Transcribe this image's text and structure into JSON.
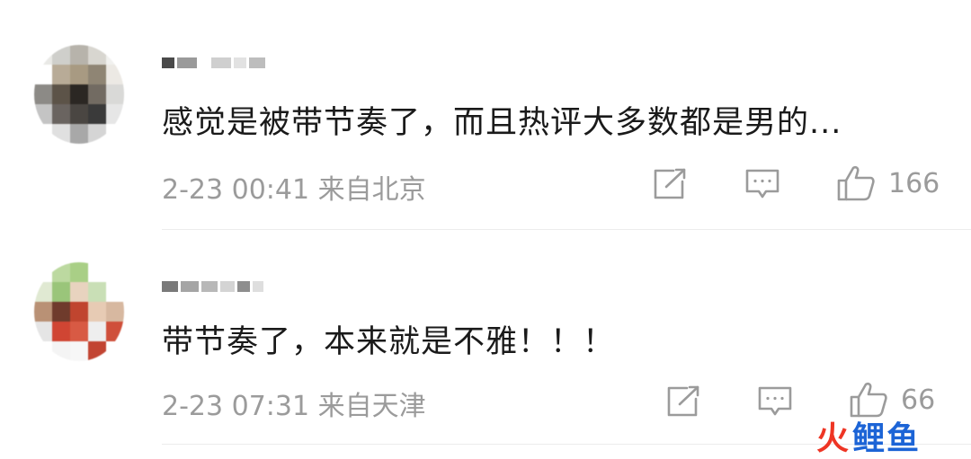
{
  "comments": [
    {
      "text": "感觉是被带节奏了，而且热评大多数都是男的...",
      "time": "2-23 00:41",
      "location": "来自北京",
      "likes": "166",
      "username_blurred": true,
      "avatar_colors": [
        "#e9e9e6",
        "#cfcfcb",
        "#b7b3ab",
        "#d8d6d0",
        "#f1f1ef",
        "#ffffff",
        "#b8ab97",
        "#a89a82",
        "#8f8574",
        "#ece9e4",
        "#8c8a86",
        "#5c5348",
        "#2b2723",
        "#726b62",
        "#d9d9d7",
        "#c4c4c4",
        "#6a6460",
        "#4a4642",
        "#3a3a3a",
        "#e6e6e6",
        "#ffffff",
        "#e0e0e0",
        "#a8a8a8",
        "#d5d5d5",
        "#ffffff"
      ]
    },
    {
      "text": "带节奏了，本来就是不雅！！！",
      "time": "2-23 07:31",
      "location": "来自天津",
      "likes": "66",
      "username_blurred": true,
      "avatar_colors": [
        "#ffffff",
        "#bcd9a0",
        "#a9cf86",
        "#ffffff",
        "#ffffff",
        "#e0e9d2",
        "#9ac57a",
        "#e8d3bf",
        "#c9dfb6",
        "#ffffff",
        "#b99175",
        "#6f3b2c",
        "#c0452f",
        "#e7cbb4",
        "#d7b8a0",
        "#e5e5e5",
        "#d04533",
        "#d85a44",
        "#eeeeee",
        "#cf4f3a",
        "#ffffff",
        "#f4f4f4",
        "#f7f7f7",
        "#c24432",
        "#ffffff"
      ]
    }
  ],
  "watermark": {
    "fire": "火",
    "word": "鲤鱼"
  },
  "colors": {
    "text": "#1a1a1a",
    "meta": "#9b9b9b",
    "icon": "#9b9b9b",
    "divider": "#ececec",
    "watermark_red": "#ee3524",
    "watermark_blue": "#1c64d6"
  },
  "icons": {
    "share": "share-icon",
    "reply": "comment-icon",
    "like": "thumbs-up-icon"
  }
}
